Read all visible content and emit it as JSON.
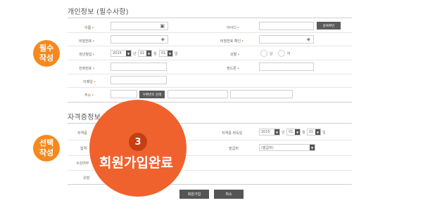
{
  "personal": {
    "title": "개인정보 (필수사항)",
    "name_label": "이름",
    "id_label": "아이디",
    "dup_check_label": "중복확인",
    "password_label": "비밀번호",
    "password_confirm_label": "비밀번호 확인",
    "birth_label": "생년월일",
    "birth_year": "2015",
    "birth_month": "01",
    "birth_day": "01",
    "year_unit": "년",
    "month_unit": "월",
    "day_unit": "일",
    "gender_label": "성별",
    "gender_male": "남",
    "gender_female": "여",
    "phone_label": "전화번호",
    "mobile_label": "핸드폰",
    "email_label": "이메일",
    "address_label": "주소",
    "zip_search_label": "우편번호 검색",
    "required_mark": "•"
  },
  "cert": {
    "title": "자격증정보 (선택사항)",
    "row1_label": "자격증",
    "row2_label": "합격",
    "row3_label": "수강여부",
    "row4_label": "유형",
    "acquired_label": "자격증 취득일",
    "acq_year": "2015",
    "acq_month": "01",
    "acq_day": "01",
    "issuer_label": "발급처",
    "issuer_select": "(발급처)"
  },
  "badges": {
    "required_line1": "필수",
    "required_line2": "작성",
    "optional_line1": "선택",
    "optional_line2": "작성"
  },
  "overlay": {
    "step_number": "3",
    "step_text": "회원가입완료"
  },
  "buttons": {
    "signup": "회원가입",
    "cancel": "취소"
  },
  "icons": {
    "name_field_icon": "▣",
    "password_field_icon": "◈",
    "password_confirm_icon": "◈",
    "dropdown_arrow": "▼"
  },
  "colors": {
    "accent_orange": "#f5891f",
    "bubble_red_orange": "#f0622d",
    "step_circle": "#c53f13"
  }
}
